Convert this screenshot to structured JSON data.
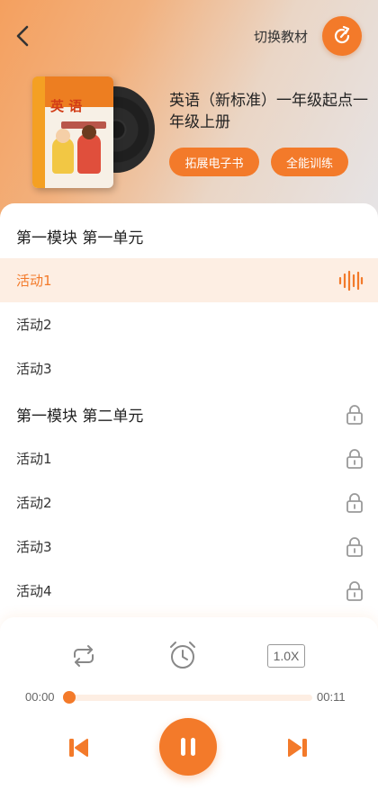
{
  "header": {
    "switch_label": "切换教材"
  },
  "book": {
    "cover_title": "英 语",
    "title": "英语（新标准）一年级起点一年级上册",
    "ebook_button": "拓展电子书",
    "training_button": "全能训练"
  },
  "lessons": [
    {
      "type": "section",
      "label": "第一模块 第一单元",
      "locked": false
    },
    {
      "type": "item",
      "label": "活动1",
      "active": true,
      "locked": false
    },
    {
      "type": "item",
      "label": "活动2",
      "active": false,
      "locked": false
    },
    {
      "type": "item",
      "label": "活动3",
      "active": false,
      "locked": false
    },
    {
      "type": "section",
      "label": "第一模块 第二单元",
      "locked": true
    },
    {
      "type": "item",
      "label": "活动1",
      "active": false,
      "locked": true
    },
    {
      "type": "item",
      "label": "活动2",
      "active": false,
      "locked": true
    },
    {
      "type": "item",
      "label": "活动3",
      "active": false,
      "locked": true
    },
    {
      "type": "item",
      "label": "活动4",
      "active": false,
      "locked": true
    }
  ],
  "player": {
    "speed": "1.0X",
    "current_time": "00:00",
    "total_time": "00:11",
    "progress": 0.0,
    "state": "playing"
  },
  "colors": {
    "accent": "#f37a2a",
    "active_row_bg": "#fdeee3"
  },
  "icons": {
    "back": "chevron-left-icon",
    "switch": "refresh-icon",
    "playing": "sound-wave-icon",
    "lock": "lock-icon",
    "loop": "loop-icon",
    "timer": "alarm-clock-icon",
    "prev": "skip-previous-icon",
    "pause": "pause-icon",
    "next": "skip-next-icon"
  }
}
